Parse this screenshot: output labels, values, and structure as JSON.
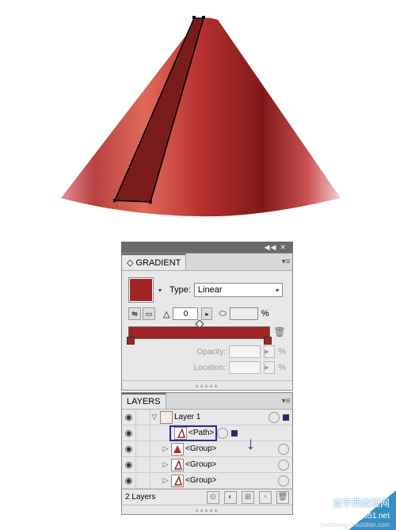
{
  "gradient_panel": {
    "tab": "GRADIENT",
    "type_label": "Type:",
    "type_value": "Linear",
    "angle_icon": "△",
    "angle_value": "0",
    "percent_label": "%",
    "opacity_label": "Opacity:",
    "opacity_pct": "%",
    "location_label": "Location:",
    "location_pct": "%",
    "swatch_color": "#a02424"
  },
  "layers_panel": {
    "tab": "LAYERS",
    "layer1_name": "Layer 1",
    "path_label": "<Path>",
    "group_label": "<Group>",
    "footer_text": "2 Layers"
  },
  "header_icons": {
    "collapse": "◀◀",
    "close": "✕"
  },
  "watermark": {
    "line1": "查字典教程网",
    "line2": "jb51.net",
    "line3": "jiaocheng.chazidian.com"
  }
}
